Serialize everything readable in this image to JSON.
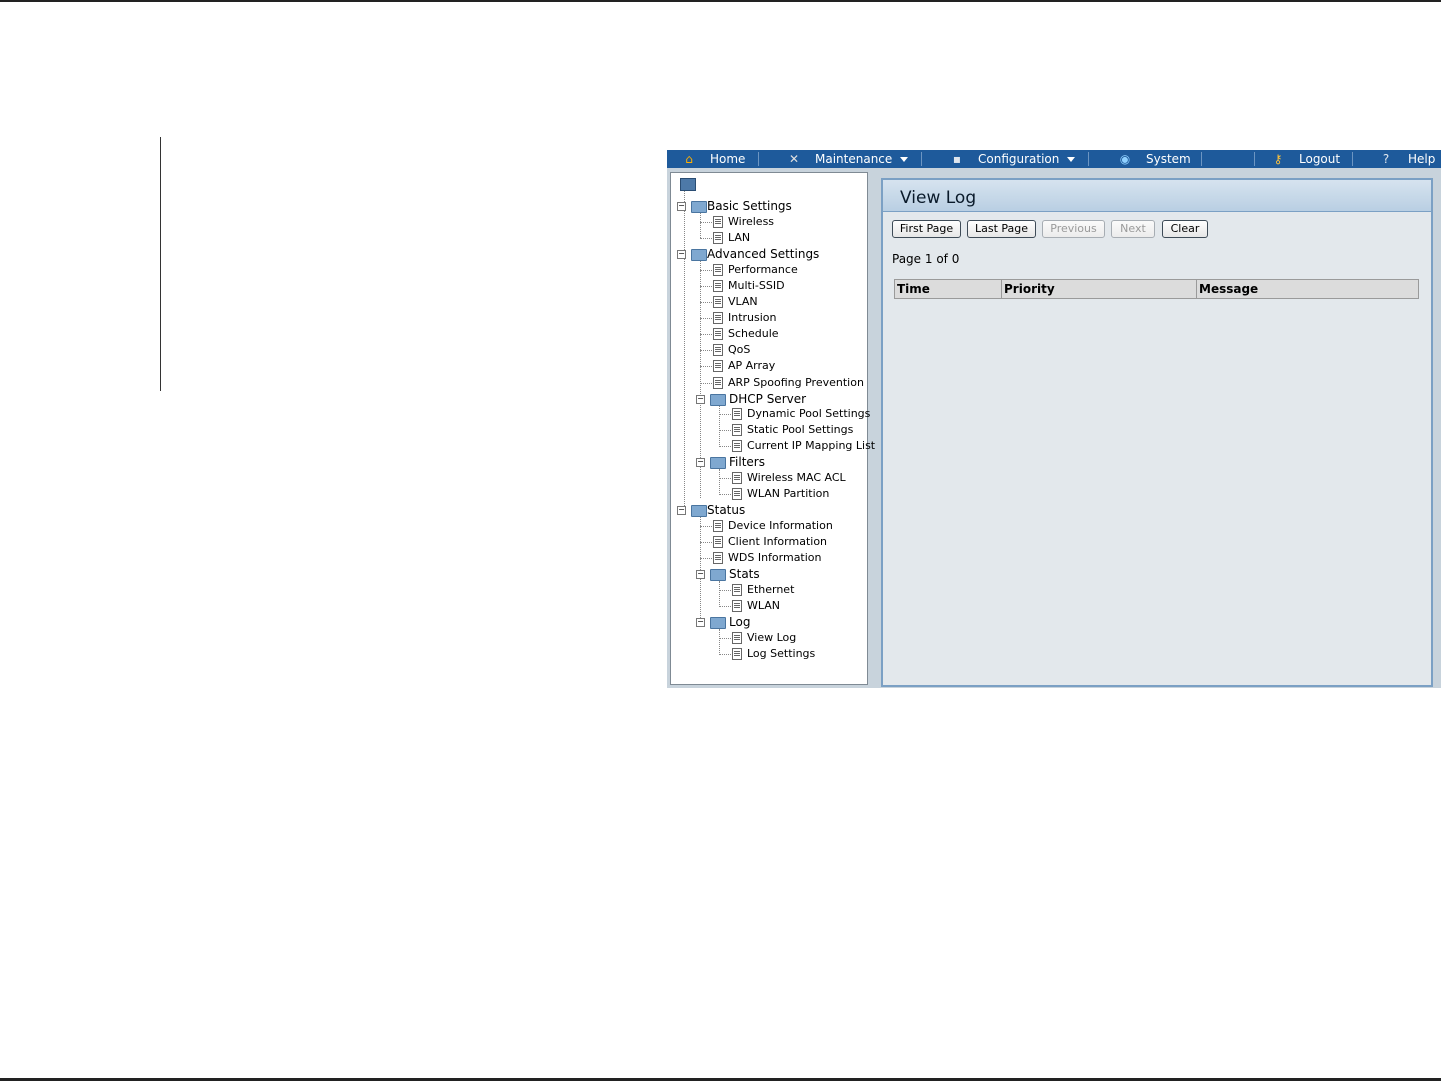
{
  "menu": {
    "items": [
      {
        "label": "Home",
        "icon": "home-icon"
      },
      {
        "label": "Maintenance",
        "icon": "tools-icon",
        "dropdown": true
      },
      {
        "label": "Configuration",
        "icon": "save-icon",
        "dropdown": true
      },
      {
        "label": "System",
        "icon": "system-icon"
      },
      {
        "label": "Logout",
        "icon": "key-icon"
      },
      {
        "label": "Help",
        "icon": "help-icon"
      }
    ]
  },
  "tree": {
    "basic": {
      "label": "Basic Settings",
      "items": [
        "Wireless",
        "LAN"
      ]
    },
    "advanced": {
      "label": "Advanced Settings",
      "items": [
        "Performance",
        "Multi-SSID",
        "VLAN",
        "Intrusion",
        "Schedule",
        "QoS",
        "AP Array",
        "ARP Spoofing Prevention"
      ],
      "dhcp": {
        "label": "DHCP Server",
        "items": [
          "Dynamic Pool Settings",
          "Static Pool Settings",
          "Current IP Mapping List"
        ]
      },
      "filters": {
        "label": "Filters",
        "items": [
          "Wireless MAC ACL",
          "WLAN Partition"
        ]
      }
    },
    "status": {
      "label": "Status",
      "items": [
        "Device Information",
        "Client Information",
        "WDS Information"
      ],
      "stats": {
        "label": "Stats",
        "items": [
          "Ethernet",
          "WLAN"
        ]
      },
      "log": {
        "label": "Log",
        "items": [
          "View Log",
          "Log Settings"
        ]
      }
    }
  },
  "content": {
    "title": "View Log",
    "buttons": {
      "first": "First Page",
      "last": "Last Page",
      "previous": "Previous",
      "next": "Next",
      "clear": "Clear"
    },
    "page_info": "Page 1 of 0",
    "table": {
      "headers": [
        "Time",
        "Priority",
        "Message"
      ]
    }
  },
  "colors": {
    "menubar": "#1e5a9b",
    "panel_border": "#7ba0c4",
    "content_bg": "#e3e8ec"
  }
}
